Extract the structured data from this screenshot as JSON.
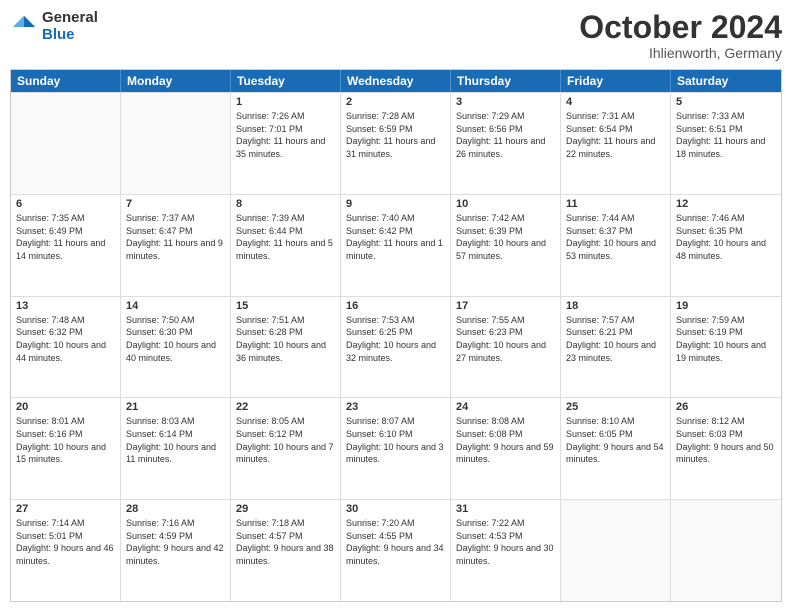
{
  "logo": {
    "general": "General",
    "blue": "Blue"
  },
  "title": "October 2024",
  "location": "Ihlienworth, Germany",
  "days": [
    "Sunday",
    "Monday",
    "Tuesday",
    "Wednesday",
    "Thursday",
    "Friday",
    "Saturday"
  ],
  "weeks": [
    [
      {
        "day": "",
        "empty": true
      },
      {
        "day": "",
        "empty": true
      },
      {
        "day": "1",
        "sunrise": "Sunrise: 7:26 AM",
        "sunset": "Sunset: 7:01 PM",
        "daylight": "Daylight: 11 hours and 35 minutes."
      },
      {
        "day": "2",
        "sunrise": "Sunrise: 7:28 AM",
        "sunset": "Sunset: 6:59 PM",
        "daylight": "Daylight: 11 hours and 31 minutes."
      },
      {
        "day": "3",
        "sunrise": "Sunrise: 7:29 AM",
        "sunset": "Sunset: 6:56 PM",
        "daylight": "Daylight: 11 hours and 26 minutes."
      },
      {
        "day": "4",
        "sunrise": "Sunrise: 7:31 AM",
        "sunset": "Sunset: 6:54 PM",
        "daylight": "Daylight: 11 hours and 22 minutes."
      },
      {
        "day": "5",
        "sunrise": "Sunrise: 7:33 AM",
        "sunset": "Sunset: 6:51 PM",
        "daylight": "Daylight: 11 hours and 18 minutes."
      }
    ],
    [
      {
        "day": "6",
        "sunrise": "Sunrise: 7:35 AM",
        "sunset": "Sunset: 6:49 PM",
        "daylight": "Daylight: 11 hours and 14 minutes."
      },
      {
        "day": "7",
        "sunrise": "Sunrise: 7:37 AM",
        "sunset": "Sunset: 6:47 PM",
        "daylight": "Daylight: 11 hours and 9 minutes."
      },
      {
        "day": "8",
        "sunrise": "Sunrise: 7:39 AM",
        "sunset": "Sunset: 6:44 PM",
        "daylight": "Daylight: 11 hours and 5 minutes."
      },
      {
        "day": "9",
        "sunrise": "Sunrise: 7:40 AM",
        "sunset": "Sunset: 6:42 PM",
        "daylight": "Daylight: 11 hours and 1 minute."
      },
      {
        "day": "10",
        "sunrise": "Sunrise: 7:42 AM",
        "sunset": "Sunset: 6:39 PM",
        "daylight": "Daylight: 10 hours and 57 minutes."
      },
      {
        "day": "11",
        "sunrise": "Sunrise: 7:44 AM",
        "sunset": "Sunset: 6:37 PM",
        "daylight": "Daylight: 10 hours and 53 minutes."
      },
      {
        "day": "12",
        "sunrise": "Sunrise: 7:46 AM",
        "sunset": "Sunset: 6:35 PM",
        "daylight": "Daylight: 10 hours and 48 minutes."
      }
    ],
    [
      {
        "day": "13",
        "sunrise": "Sunrise: 7:48 AM",
        "sunset": "Sunset: 6:32 PM",
        "daylight": "Daylight: 10 hours and 44 minutes."
      },
      {
        "day": "14",
        "sunrise": "Sunrise: 7:50 AM",
        "sunset": "Sunset: 6:30 PM",
        "daylight": "Daylight: 10 hours and 40 minutes."
      },
      {
        "day": "15",
        "sunrise": "Sunrise: 7:51 AM",
        "sunset": "Sunset: 6:28 PM",
        "daylight": "Daylight: 10 hours and 36 minutes."
      },
      {
        "day": "16",
        "sunrise": "Sunrise: 7:53 AM",
        "sunset": "Sunset: 6:25 PM",
        "daylight": "Daylight: 10 hours and 32 minutes."
      },
      {
        "day": "17",
        "sunrise": "Sunrise: 7:55 AM",
        "sunset": "Sunset: 6:23 PM",
        "daylight": "Daylight: 10 hours and 27 minutes."
      },
      {
        "day": "18",
        "sunrise": "Sunrise: 7:57 AM",
        "sunset": "Sunset: 6:21 PM",
        "daylight": "Daylight: 10 hours and 23 minutes."
      },
      {
        "day": "19",
        "sunrise": "Sunrise: 7:59 AM",
        "sunset": "Sunset: 6:19 PM",
        "daylight": "Daylight: 10 hours and 19 minutes."
      }
    ],
    [
      {
        "day": "20",
        "sunrise": "Sunrise: 8:01 AM",
        "sunset": "Sunset: 6:16 PM",
        "daylight": "Daylight: 10 hours and 15 minutes."
      },
      {
        "day": "21",
        "sunrise": "Sunrise: 8:03 AM",
        "sunset": "Sunset: 6:14 PM",
        "daylight": "Daylight: 10 hours and 11 minutes."
      },
      {
        "day": "22",
        "sunrise": "Sunrise: 8:05 AM",
        "sunset": "Sunset: 6:12 PM",
        "daylight": "Daylight: 10 hours and 7 minutes."
      },
      {
        "day": "23",
        "sunrise": "Sunrise: 8:07 AM",
        "sunset": "Sunset: 6:10 PM",
        "daylight": "Daylight: 10 hours and 3 minutes."
      },
      {
        "day": "24",
        "sunrise": "Sunrise: 8:08 AM",
        "sunset": "Sunset: 6:08 PM",
        "daylight": "Daylight: 9 hours and 59 minutes."
      },
      {
        "day": "25",
        "sunrise": "Sunrise: 8:10 AM",
        "sunset": "Sunset: 6:05 PM",
        "daylight": "Daylight: 9 hours and 54 minutes."
      },
      {
        "day": "26",
        "sunrise": "Sunrise: 8:12 AM",
        "sunset": "Sunset: 6:03 PM",
        "daylight": "Daylight: 9 hours and 50 minutes."
      }
    ],
    [
      {
        "day": "27",
        "sunrise": "Sunrise: 7:14 AM",
        "sunset": "Sunset: 5:01 PM",
        "daylight": "Daylight: 9 hours and 46 minutes."
      },
      {
        "day": "28",
        "sunrise": "Sunrise: 7:16 AM",
        "sunset": "Sunset: 4:59 PM",
        "daylight": "Daylight: 9 hours and 42 minutes."
      },
      {
        "day": "29",
        "sunrise": "Sunrise: 7:18 AM",
        "sunset": "Sunset: 4:57 PM",
        "daylight": "Daylight: 9 hours and 38 minutes."
      },
      {
        "day": "30",
        "sunrise": "Sunrise: 7:20 AM",
        "sunset": "Sunset: 4:55 PM",
        "daylight": "Daylight: 9 hours and 34 minutes."
      },
      {
        "day": "31",
        "sunrise": "Sunrise: 7:22 AM",
        "sunset": "Sunset: 4:53 PM",
        "daylight": "Daylight: 9 hours and 30 minutes."
      },
      {
        "day": "",
        "empty": true
      },
      {
        "day": "",
        "empty": true
      }
    ]
  ]
}
